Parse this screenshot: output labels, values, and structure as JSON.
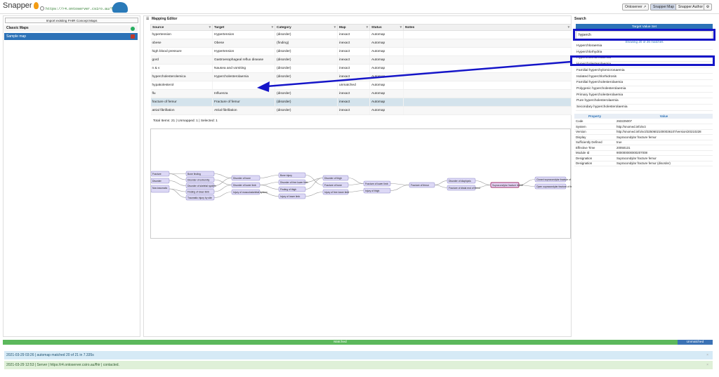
{
  "app": {
    "name": "Snapper",
    "url": "https://r4.ontoserver.csiro.au/fhir",
    "nav": {
      "ontoserver": "Ontoserver",
      "map": "Snapper:Map",
      "author": "Snapper:Author"
    }
  },
  "left": {
    "import_label": "Import existing FHIR Concept Maps",
    "section_title": "Classic Maps",
    "items": [
      {
        "label": "Sample map"
      }
    ]
  },
  "editor": {
    "title": "Mapping Editor",
    "columns": [
      "Source",
      "Target",
      "Category",
      "Map",
      "Status",
      "Notes"
    ],
    "rows": [
      {
        "source": "hypertension",
        "target": "Hypertension",
        "category": "(disorder)",
        "map": "inexact",
        "status": "Automap"
      },
      {
        "source": "obese",
        "target": "Obese",
        "category": "(finding)",
        "map": "inexact",
        "status": "Automap"
      },
      {
        "source": "high blood pressure",
        "target": "Hypertension",
        "category": "(disorder)",
        "map": "inexact",
        "status": "Automap"
      },
      {
        "source": "gord",
        "target": "Gastroesophageal reflux disease",
        "category": "(disorder)",
        "map": "inexact",
        "status": "Automap"
      },
      {
        "source": "n & v",
        "target": "Nausea and vomiting",
        "category": "(disorder)",
        "map": "inexact",
        "status": "Automap"
      },
      {
        "source": "hypercholesterolemica",
        "target": "Hypercholesterolaemia",
        "category": "(disorder)",
        "map": "inexact",
        "status": "Automap"
      },
      {
        "source": "hypakolesterol",
        "target": "",
        "category": "",
        "map": "unmatched",
        "status": "Automap"
      },
      {
        "source": "flu",
        "target": "Influenza",
        "category": "(disorder)",
        "map": "inexact",
        "status": "Automap"
      },
      {
        "source": "fracture of femur",
        "target": "Fracture of femur",
        "category": "(disorder)",
        "map": "inexact",
        "status": "Automap"
      },
      {
        "source": "atrial fibrillation",
        "target": "Atrial fibrillation",
        "category": "(disorder)",
        "map": "inexact",
        "status": "Automap"
      }
    ],
    "footer": "Total Items: 21 | Unmapped: 1 | Selected: 1"
  },
  "graph": {
    "nodes": [
      "Fracture",
      "Disorder",
      "Non-traumatic",
      "Bone finding",
      "Disorder of extremity",
      "Disorder of skeletal system",
      "Finding of lower limb",
      "Traumatic injury by site",
      "Disorder of bone",
      "Disorder of lower limb",
      "Injury of musculoskeletal system",
      "Bone injury",
      "Disorder of free lower limb",
      "Finding of thigh",
      "Injury of lower limb",
      "Disorder of thigh",
      "Fracture of bone",
      "Injury of free lower limb",
      "Fracture of lower limb",
      "Injury of thigh",
      "Fracture of femur",
      "Disorder of diaphysis",
      "Fracture of distal end of femur",
      "Supracondylar fracture femur",
      "Closed supracondylar fracture of femur",
      "Open supracondylar fracture of femur"
    ]
  },
  "search": {
    "title": "Search",
    "target_value_set": "Target Value Set",
    "query": "hyperch",
    "showing": "Showing 20 of 26 matches",
    "results": [
      "Hyperchloraemia",
      "Hyperchlorhydria",
      "Hypercholesterolaemia",
      "Hypercholesterolaemia",
      "Familial hyperchylomicronaemia",
      "Isolated hyperchlorhidrosis",
      "Familial hypercholesterolaemia",
      "Polygenic hypercholesterolaemia",
      "Primary hypercholesterolaemia",
      "Pure hypercholesterolaemia",
      "Secondary hypercholesterolaemia"
    ],
    "props_header": [
      "Property",
      "Value"
    ],
    "props": [
      [
        "Code",
        "263225007"
      ],
      [
        "System",
        "http://snomed.info/sct"
      ],
      [
        "Version",
        "http://snomed.info/sct/32506021000036107/version/20210228"
      ],
      [
        "Display",
        "Supracondylar fracture femur"
      ],
      [
        "Sufficiently Defined",
        "true"
      ],
      [
        "Effective Time",
        "20050131"
      ],
      [
        "Module Id",
        "900000000000207008"
      ],
      [
        "Designation",
        "Supracondylar fracture femur"
      ],
      [
        "Designation",
        "Supracondylar fracture femur (disorder)"
      ]
    ]
  },
  "status_bar": {
    "matched": "Matched",
    "unmatched": "Unmatched",
    "matched_count": 20,
    "total": 21
  },
  "log": [
    "2021-03-29 03:26 | automap matched 20 of 21 in 7.335s",
    "2021-03-29 12:53 | Server | https://r4.ontoserver.csiro.au/fhir | contacted."
  ],
  "colors": {
    "accent": "#2c72b7",
    "matched": "#5cb85c",
    "highlight": "#1515c8"
  }
}
